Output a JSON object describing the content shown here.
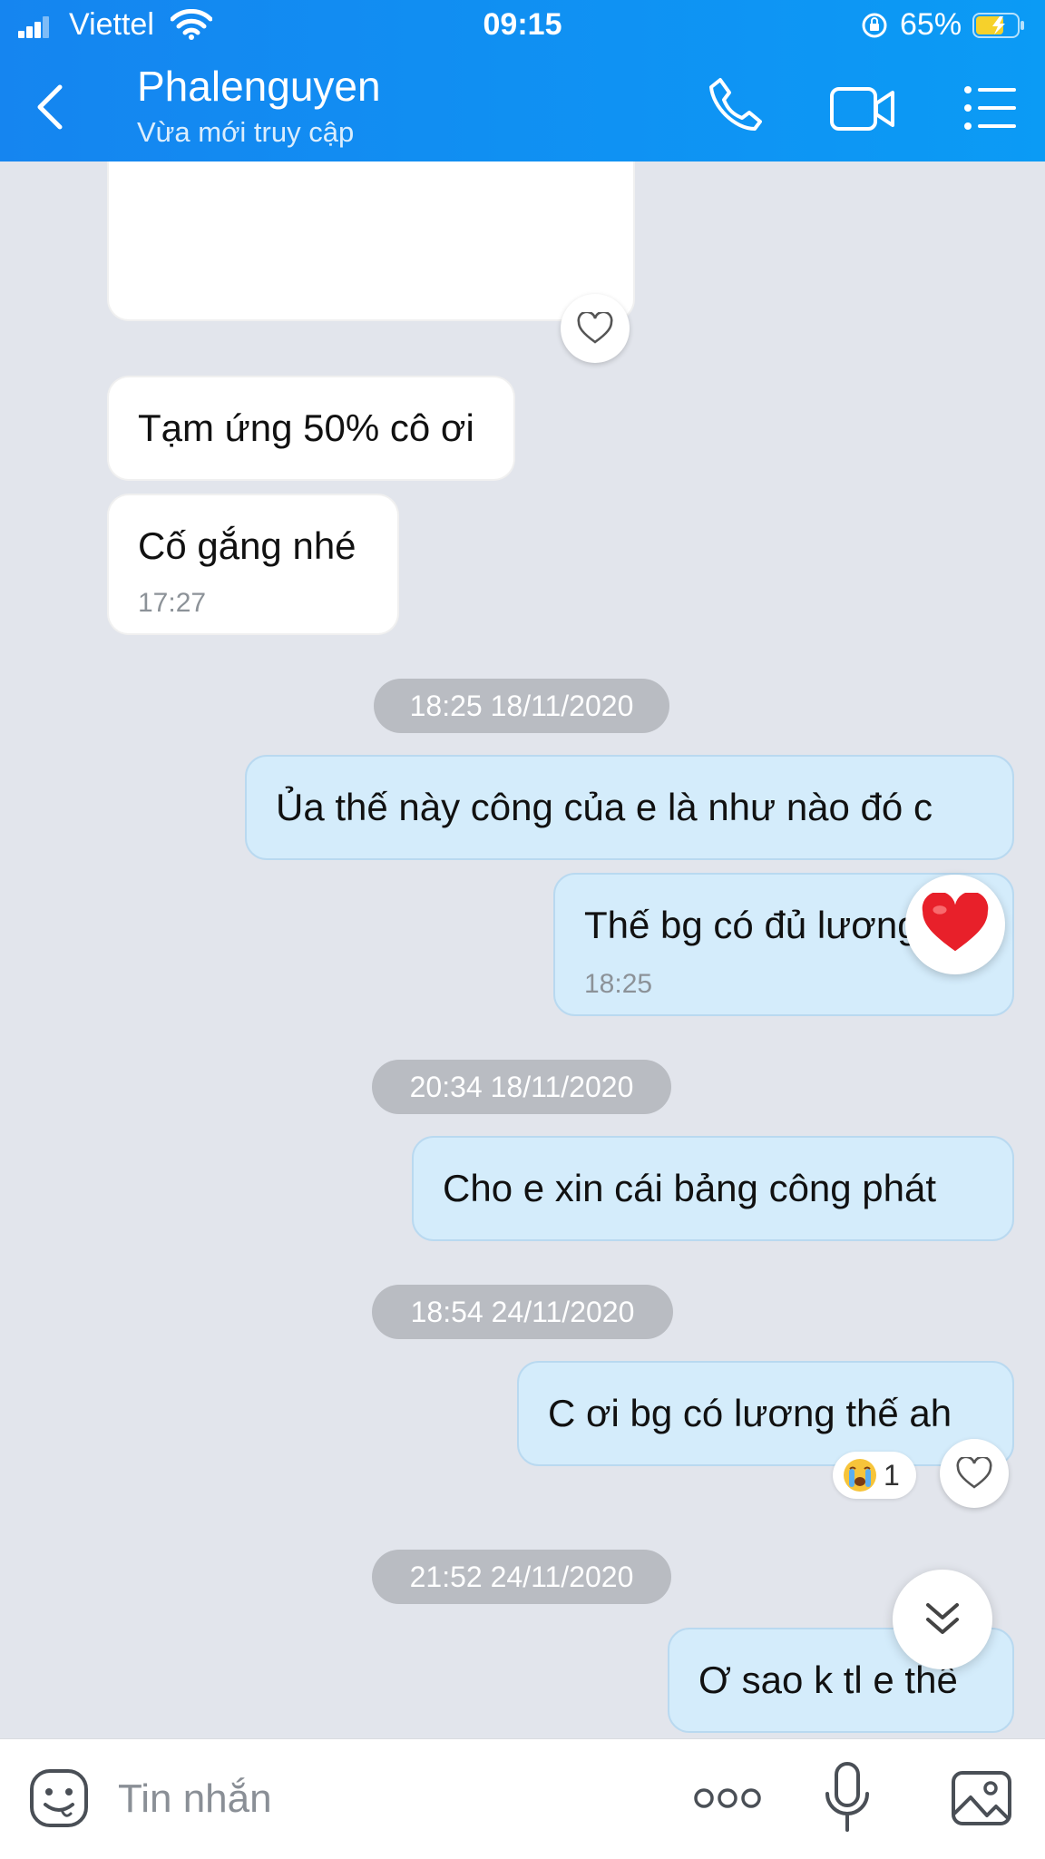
{
  "status_bar": {
    "carrier": "Viettel",
    "time": "09:15",
    "battery_percent": "65%"
  },
  "header": {
    "contact_name": "Phalenguyen",
    "presence": "Vừa mới truy cập"
  },
  "messages": [
    {
      "text": "Tạm ứng 50% cô ơi"
    },
    {
      "text": "Cố gắng nhé",
      "time": "17:27"
    },
    {
      "text": "Ủa thế này công của e là như nào đó c"
    },
    {
      "text": "Thế bg có đủ lương",
      "time": "18:25"
    },
    {
      "text": "Cho e xin cái bảng công phát"
    },
    {
      "text": "C ơi bg có lương thế ah",
      "reaction_count": "1"
    },
    {
      "text": "Ơ sao k tl e thế"
    }
  ],
  "date_separators": [
    "18:25 18/11/2020",
    "20:34 18/11/2020",
    "18:54 24/11/2020",
    "21:52 24/11/2020"
  ],
  "input": {
    "placeholder": "Tin nhắn"
  },
  "colors": {
    "header_gradient_start": "#1585f0",
    "header_gradient_end": "#0b9bf5",
    "chat_background": "#e2e5ec",
    "outgoing_bubble": "#d4ecfb",
    "incoming_bubble": "#ffffff",
    "date_pill": "#b9bcc2",
    "heart_red": "#e8202a"
  },
  "icons": {
    "back": "back-arrow-icon",
    "call": "phone-icon",
    "video": "video-camera-icon",
    "menu": "list-menu-icon",
    "like": "heart-icon",
    "reaction": "crying-face-icon",
    "scroll": "double-chevron-down-icon",
    "sticker": "emoji-face-icon",
    "more": "more-dots-icon",
    "voice": "microphone-icon",
    "image": "image-icon"
  }
}
